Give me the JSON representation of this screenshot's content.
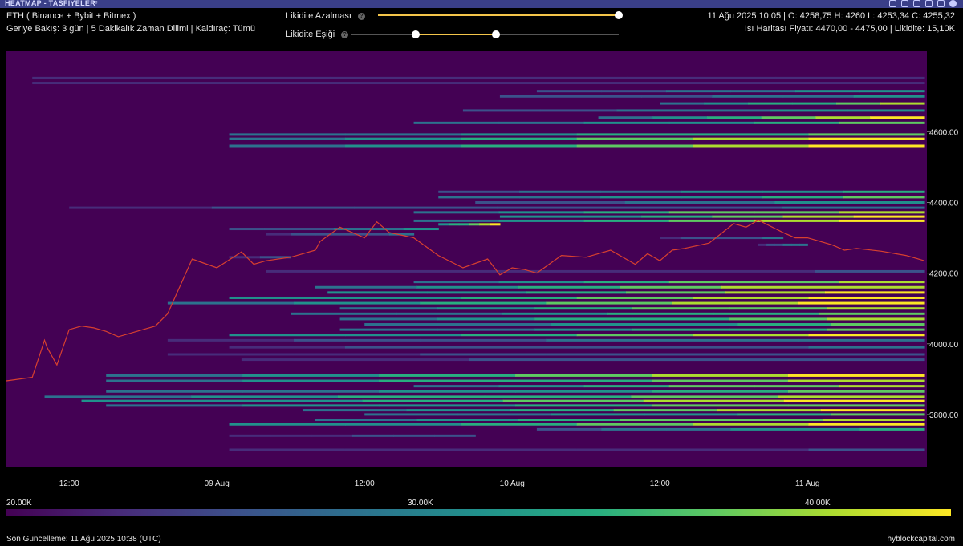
{
  "window": {
    "title": "HEATMAP - TASFİYELER",
    "icons": [
      "refresh-icon",
      "camera-icon",
      "home-icon",
      "table-icon",
      "download-icon",
      "close-icon"
    ]
  },
  "header": {
    "symbol_line": "ETH ( Binance + Bybit + Bitmex )",
    "settings_line": "Geriye Bakış: 3 gün | 5 Dakikalık Zaman Dilimi | Kaldıraç: Tümü",
    "ohlc_line": "11 Ağu 2025 10:05 | O: 4258,75 H: 4260 L: 4253,34 C: 4255,32",
    "heat_line": "Isı Haritası Fiyatı: 4470,00 - 4475,00 | Likidite: 15,10K"
  },
  "controls": {
    "decay_label": "Likidite Azalması",
    "decay_value": 1.0,
    "threshold_label": "Likidite Eşiği",
    "threshold_low": 0.24,
    "threshold_high": 0.54,
    "help_glyph": "?"
  },
  "colorbar": {
    "labels": [
      "20.00K",
      "30.00K",
      "40.00K"
    ]
  },
  "footer": {
    "updated": "Son Güncelleme: 11 Ağu 2025 10:38 (UTC)",
    "brand": "hyblockcapital.com"
  },
  "chart_data": {
    "type": "heatmap",
    "x_tick_labels": [
      "12:00",
      "09 Aug",
      "12:00",
      "10 Aug",
      "12:00",
      "11 Aug"
    ],
    "y_tick_labels": [
      "4600.00",
      "4400.00",
      "4200.00",
      "4000.00",
      "3800.00"
    ],
    "y_ticks": [
      4600,
      4400,
      4200,
      4000,
      3800
    ],
    "ylim": [
      3650,
      4830
    ],
    "x_ticks_hours": [
      12,
      24,
      36,
      48,
      60,
      72
    ],
    "xlim_hours": [
      6.9,
      81.7
    ],
    "colorscale": [
      "#440154",
      "#472c7a",
      "#3b528b",
      "#2c728e",
      "#21918c",
      "#28ae80",
      "#5ec962",
      "#addc30",
      "#fde725"
    ],
    "colorbar_ticks_k": [
      20,
      30,
      40
    ],
    "price_line_color": "#d8402f",
    "price_series": {
      "x_hours": [
        6.9,
        9,
        10,
        10.2,
        11,
        12,
        13,
        14,
        15,
        16,
        18,
        19,
        20,
        22,
        24,
        26,
        27,
        28,
        30,
        32,
        32.4,
        34,
        36,
        37,
        38,
        40,
        42,
        44,
        46,
        47,
        48,
        49,
        50,
        51,
        52,
        54,
        56,
        58,
        59,
        60,
        61,
        62,
        64,
        66,
        67,
        68,
        70,
        71,
        72,
        74,
        75,
        76,
        78,
        80,
        81.5
      ],
      "y": [
        3895,
        3905,
        4010,
        3990,
        3940,
        4040,
        4050,
        4045,
        4035,
        4020,
        4040,
        4050,
        4085,
        4240,
        4215,
        4260,
        4225,
        4235,
        4245,
        4265,
        4290,
        4330,
        4300,
        4345,
        4315,
        4300,
        4250,
        4215,
        4240,
        4195,
        4215,
        4210,
        4200,
        4225,
        4250,
        4245,
        4265,
        4225,
        4255,
        4235,
        4265,
        4270,
        4285,
        4340,
        4330,
        4350,
        4315,
        4300,
        4300,
        4280,
        4265,
        4270,
        4262,
        4250,
        4235
      ]
    },
    "bands": [
      {
        "y": 4752,
        "x0": 9.0,
        "x1": 81.5,
        "lv": 0.18
      },
      {
        "y": 4738,
        "x0": 9.0,
        "x1": 81.5,
        "lv": 0.15
      },
      {
        "y": 4715,
        "x0": 50.0,
        "x1": 81.5,
        "lv": 0.55
      },
      {
        "y": 4700,
        "x0": 47.0,
        "x1": 81.5,
        "lv": 0.45
      },
      {
        "y": 4680,
        "x0": 60.0,
        "x1": 81.5,
        "lv": 0.85
      },
      {
        "y": 4660,
        "x0": 44.0,
        "x1": 81.5,
        "lv": 0.55
      },
      {
        "y": 4640,
        "x0": 55.0,
        "x1": 81.5,
        "lv": 0.95
      },
      {
        "y": 4625,
        "x0": 40.0,
        "x1": 81.5,
        "lv": 0.7
      },
      {
        "y": 4592,
        "x0": 25.0,
        "x1": 81.5,
        "lv": 0.75
      },
      {
        "y": 4580,
        "x0": 25.0,
        "x1": 81.5,
        "lv": 0.95
      },
      {
        "y": 4560,
        "x0": 25.0,
        "x1": 81.5,
        "lv": 0.95
      },
      {
        "y": 4430,
        "x0": 42.0,
        "x1": 81.5,
        "lv": 0.6
      },
      {
        "y": 4415,
        "x0": 42.0,
        "x1": 81.5,
        "lv": 0.7
      },
      {
        "y": 4400,
        "x0": 45.0,
        "x1": 81.5,
        "lv": 0.55
      },
      {
        "y": 4385,
        "x0": 12.0,
        "x1": 81.5,
        "lv": 0.35
      },
      {
        "y": 4372,
        "x0": 40.0,
        "x1": 81.5,
        "lv": 0.9
      },
      {
        "y": 4360,
        "x0": 47.0,
        "x1": 81.5,
        "lv": 0.98
      },
      {
        "y": 4348,
        "x0": 40.0,
        "x1": 81.5,
        "lv": 0.95
      },
      {
        "y": 4338,
        "x0": 42.0,
        "x1": 47.0,
        "lv": 1.0
      },
      {
        "y": 4325,
        "x0": 25.0,
        "x1": 42.0,
        "lv": 0.45
      },
      {
        "y": 4310,
        "x0": 28.0,
        "x1": 40.0,
        "lv": 0.35
      },
      {
        "y": 4300,
        "x0": 60.0,
        "x1": 70.0,
        "lv": 0.35
      },
      {
        "y": 4280,
        "x0": 68.0,
        "x1": 72.0,
        "lv": 0.4
      },
      {
        "y": 4245,
        "x0": 25.0,
        "x1": 30.0,
        "lv": 0.25
      },
      {
        "y": 4205,
        "x0": 28.0,
        "x1": 81.5,
        "lv": 0.2
      },
      {
        "y": 4175,
        "x0": 40.0,
        "x1": 81.5,
        "lv": 0.9
      },
      {
        "y": 4160,
        "x0": 32.0,
        "x1": 81.5,
        "lv": 0.92
      },
      {
        "y": 4145,
        "x0": 33.0,
        "x1": 81.5,
        "lv": 0.98
      },
      {
        "y": 4130,
        "x0": 25.0,
        "x1": 81.5,
        "lv": 0.98
      },
      {
        "y": 4115,
        "x0": 20.0,
        "x1": 81.5,
        "lv": 0.95
      },
      {
        "y": 4100,
        "x0": 34.0,
        "x1": 81.5,
        "lv": 0.9
      },
      {
        "y": 4085,
        "x0": 30.0,
        "x1": 81.5,
        "lv": 0.75
      },
      {
        "y": 4070,
        "x0": 34.0,
        "x1": 81.5,
        "lv": 0.85
      },
      {
        "y": 4055,
        "x0": 36.0,
        "x1": 81.5,
        "lv": 0.7
      },
      {
        "y": 4040,
        "x0": 34.0,
        "x1": 81.5,
        "lv": 0.75
      },
      {
        "y": 4025,
        "x0": 25.0,
        "x1": 81.5,
        "lv": 0.97
      },
      {
        "y": 4010,
        "x0": 20.0,
        "x1": 81.5,
        "lv": 0.4
      },
      {
        "y": 3990,
        "x0": 25.0,
        "x1": 81.5,
        "lv": 0.35
      },
      {
        "y": 3970,
        "x0": 20.0,
        "x1": 81.5,
        "lv": 0.3
      },
      {
        "y": 3955,
        "x0": 26.0,
        "x1": 81.5,
        "lv": 0.3
      },
      {
        "y": 3910,
        "x0": 15.0,
        "x1": 81.5,
        "lv": 0.95
      },
      {
        "y": 3895,
        "x0": 15.0,
        "x1": 81.5,
        "lv": 0.85
      },
      {
        "y": 3880,
        "x0": 40.0,
        "x1": 81.5,
        "lv": 0.9
      },
      {
        "y": 3865,
        "x0": 15.0,
        "x1": 81.5,
        "lv": 0.7
      },
      {
        "y": 3850,
        "x0": 10.0,
        "x1": 81.5,
        "lv": 0.85
      },
      {
        "y": 3838,
        "x0": 13.0,
        "x1": 81.5,
        "lv": 0.98
      },
      {
        "y": 3825,
        "x0": 15.0,
        "x1": 81.5,
        "lv": 0.8
      },
      {
        "y": 3812,
        "x0": 31.0,
        "x1": 81.5,
        "lv": 0.95
      },
      {
        "y": 3800,
        "x0": 36.0,
        "x1": 81.5,
        "lv": 0.7
      },
      {
        "y": 3785,
        "x0": 32.0,
        "x1": 81.5,
        "lv": 0.9
      },
      {
        "y": 3772,
        "x0": 25.0,
        "x1": 81.5,
        "lv": 0.98
      },
      {
        "y": 3758,
        "x0": 50.0,
        "x1": 81.5,
        "lv": 0.6
      },
      {
        "y": 3740,
        "x0": 25.0,
        "x1": 45.0,
        "lv": 0.25
      },
      {
        "y": 3700,
        "x0": 25.0,
        "x1": 81.5,
        "lv": 0.2
      }
    ]
  }
}
